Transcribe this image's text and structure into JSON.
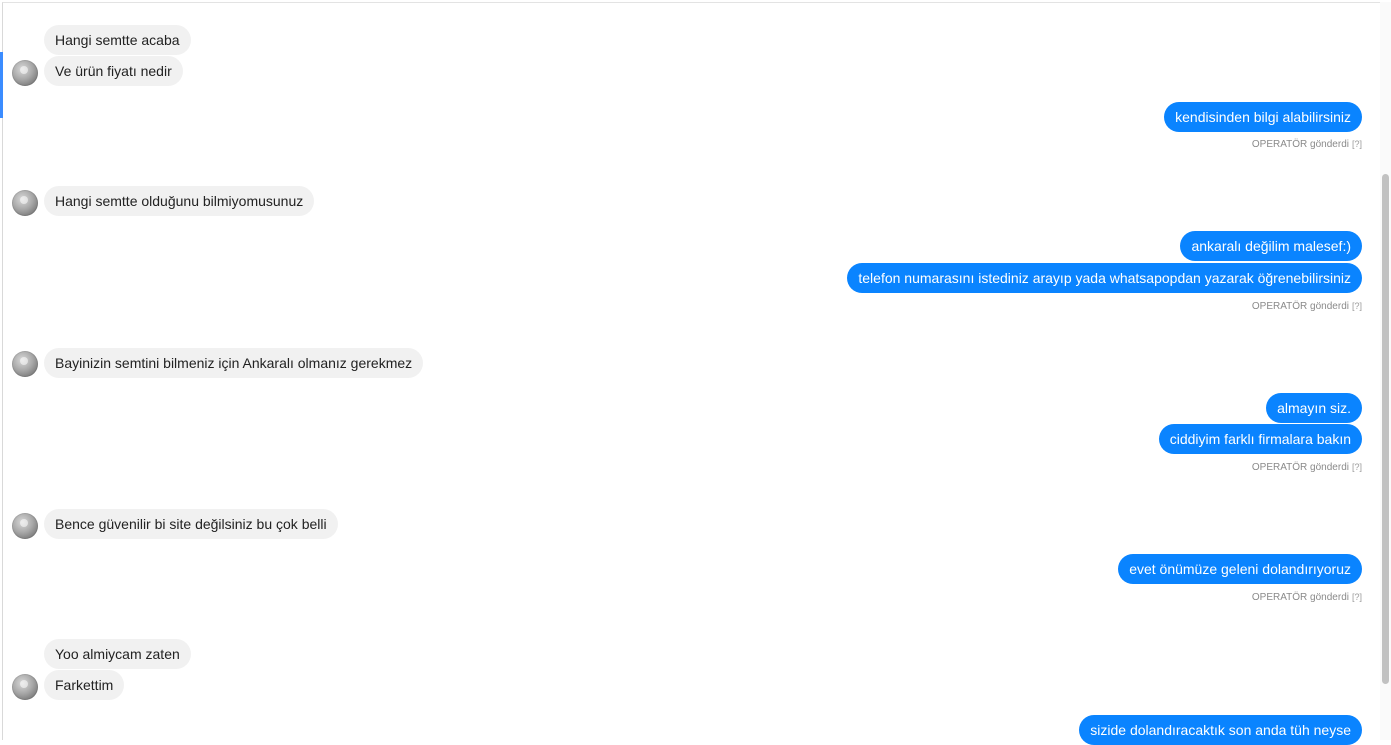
{
  "messages": [
    {
      "text": "Hangi semtte acaba"
    },
    {
      "text": "Ve ürün fiyatı nedir"
    },
    {
      "text": "kendisinden bilgi alabilirsiniz"
    },
    {
      "text": "Hangi semtte olduğunu bilmiyomusunuz"
    },
    {
      "text": "ankaralı değilim malesef:)"
    },
    {
      "text": "telefon numarasını istediniz arayıp yada whatsapopdan yazarak öğrenebilirsiniz"
    },
    {
      "text": "Bayinizin semtini bilmeniz için Ankaralı olmanız gerekmez"
    },
    {
      "text": "almayın siz."
    },
    {
      "text": "ciddiyim farklı firmalara bakın"
    },
    {
      "text": "Bence güvenilir bi site değilsiniz bu çok belli"
    },
    {
      "text": "evet önümüze geleni dolandırıyoruz"
    },
    {
      "text": "Yoo almiycam zaten"
    },
    {
      "text": "Farkettim"
    },
    {
      "text": "sizide dolandıracaktık son anda tüh neyse"
    }
  ],
  "meta": {
    "sent_by_label": "OPERATÖR gönderdi",
    "help_label": "[?]"
  },
  "colors": {
    "outgoing_bubble": "#0a84ff",
    "incoming_bubble": "#f1f1f1",
    "accent": "#3b8cff"
  },
  "icons": {
    "avatar": "user-avatar-icon"
  }
}
